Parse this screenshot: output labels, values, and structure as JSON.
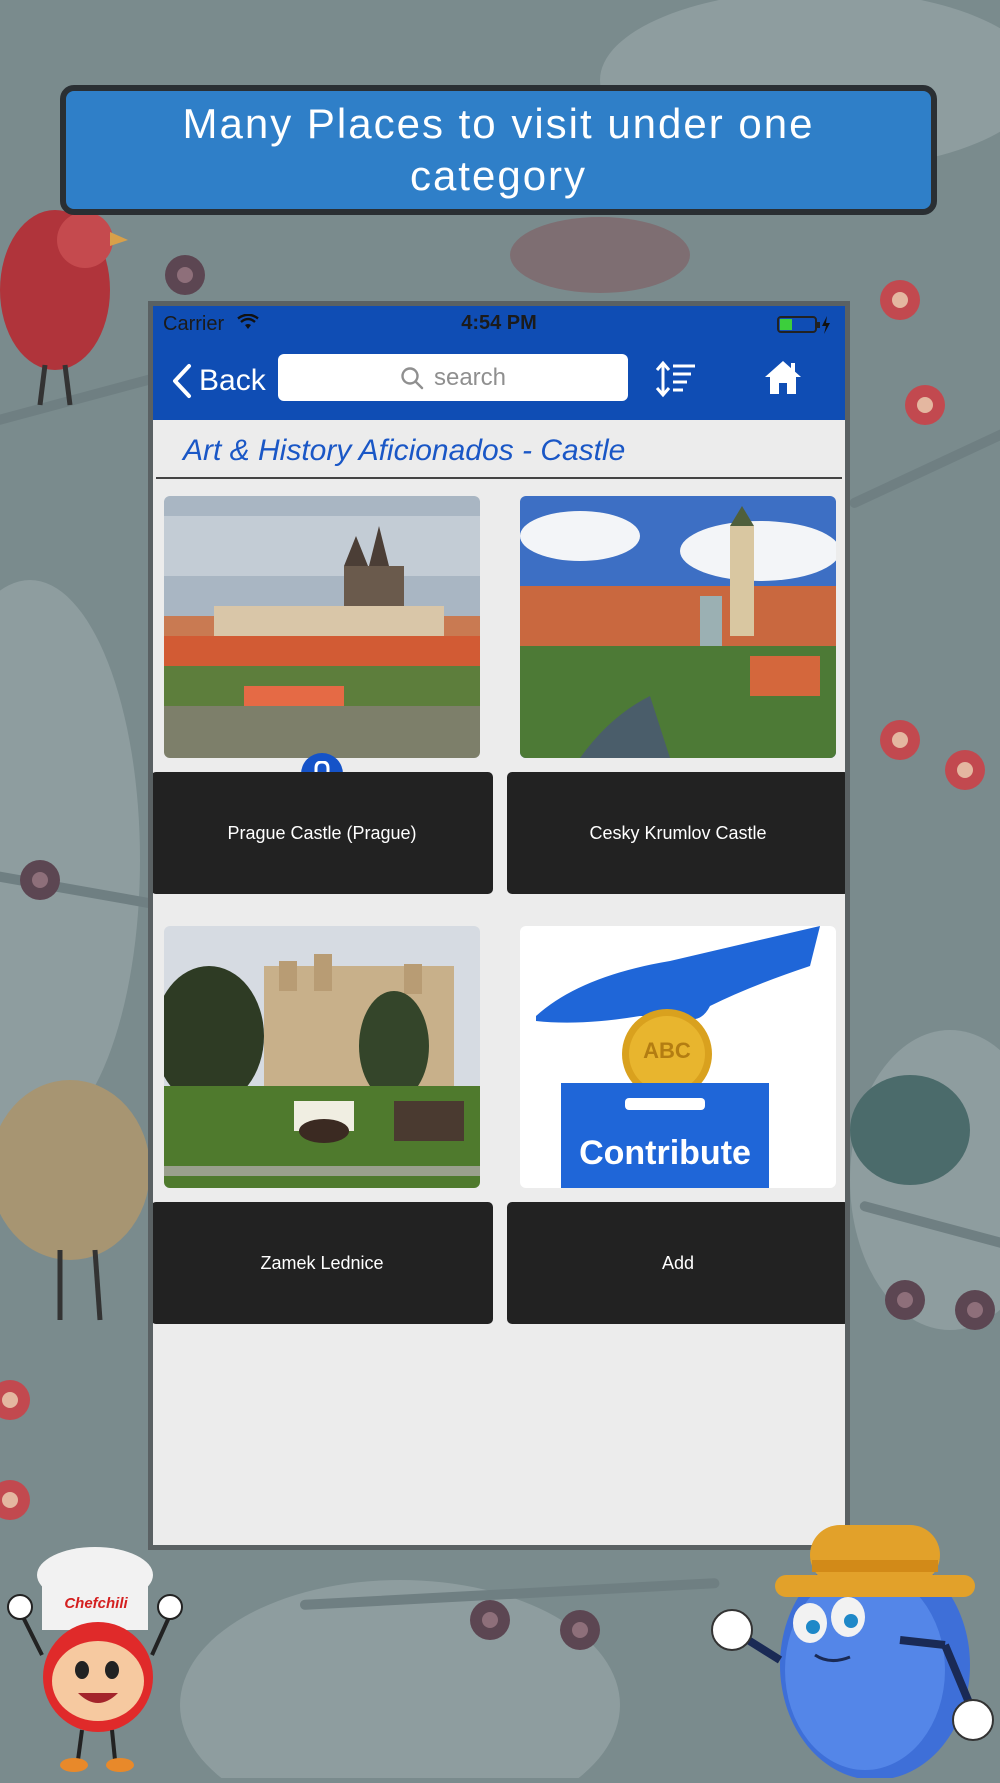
{
  "banner": {
    "text": "Many Places to visit under one category"
  },
  "status_bar": {
    "carrier": "Carrier",
    "time": "4:54 PM"
  },
  "navbar": {
    "back_label": "Back",
    "search_placeholder": "search"
  },
  "section": {
    "title": "Art & History Aficionados - Castle"
  },
  "cards": [
    {
      "label": "Prague Castle (Prague)",
      "locked": true
    },
    {
      "label": "Cesky Krumlov Castle",
      "locked": false
    },
    {
      "label": "Zamek Lednice",
      "locked": false
    },
    {
      "label": "Add",
      "locked": false,
      "image_text": "Contribute",
      "coin_text": "ABC"
    }
  ],
  "mascots": {
    "chef_logo": "Chefchili"
  },
  "colors": {
    "nav_blue": "#0f4db4",
    "banner_blue": "#2f7fc8",
    "card_dark": "#222222",
    "title_blue": "#1a57c6"
  }
}
